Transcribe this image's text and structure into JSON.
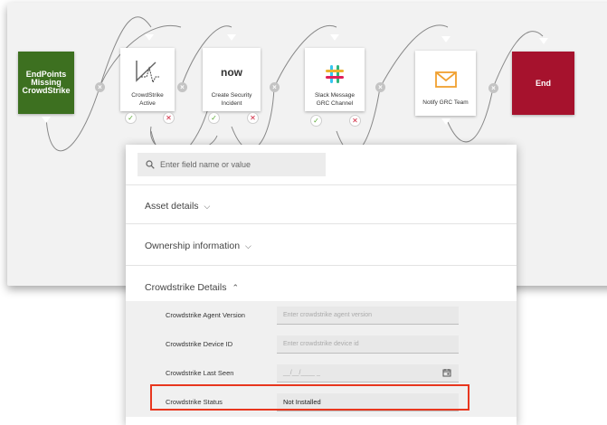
{
  "workflow": {
    "start_label": "EndPoints Missing CrowdStrike",
    "nodes": [
      {
        "label": "CrowdStrike Active",
        "icon": "crowdstrike-logo-icon"
      },
      {
        "label": "Create Security Incident",
        "icon": "servicenow-logo-icon",
        "logo_text": "now"
      },
      {
        "label": "Slack Message GRC Channel",
        "icon": "slack-logo-icon"
      },
      {
        "label": "Notify GRC Team",
        "icon": "envelope-icon"
      }
    ],
    "end_label": "End",
    "colors": {
      "start": "#3d7020",
      "end": "#a6122d",
      "check": "#5aa832",
      "cross": "#d0263e"
    }
  },
  "form": {
    "search_placeholder": "Enter field name or value",
    "sections": [
      {
        "title": "Asset details",
        "state": "collapsed"
      },
      {
        "title": "Ownership information",
        "state": "collapsed"
      },
      {
        "title": "Crowdstrike Details",
        "state": "expanded"
      }
    ],
    "fields": [
      {
        "label": "Crowdstrike Agent Version",
        "placeholder": "Enter crowdstrike agent version",
        "value": ""
      },
      {
        "label": "Crowdstrike Device ID",
        "placeholder": "Enter crowdstrike device id",
        "value": ""
      },
      {
        "label": "Crowdstrike Last Seen",
        "placeholder": "__/__/____ _",
        "value": ""
      },
      {
        "label": "Crowdstrike Status",
        "placeholder": "",
        "value": "Not Installed"
      }
    ],
    "highlight_color": "#e8361e"
  }
}
